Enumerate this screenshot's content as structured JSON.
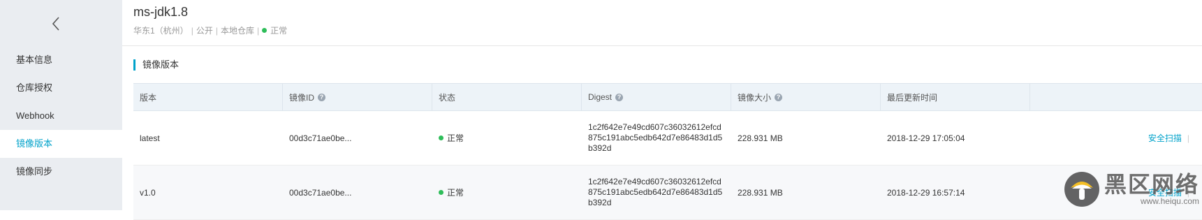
{
  "sidebar": {
    "back_icon": "chevron-left-icon",
    "items": [
      {
        "label": "基本信息",
        "active": false
      },
      {
        "label": "仓库授权",
        "active": false
      },
      {
        "label": "Webhook",
        "active": false
      },
      {
        "label": "镜像版本",
        "active": true
      },
      {
        "label": "镜像同步",
        "active": false
      }
    ]
  },
  "header": {
    "title": "ms-jdk1.8",
    "region": "华东1（杭州）",
    "visibility": "公开",
    "repo_type": "本地仓库",
    "status": "正常",
    "status_color": "#2ebd59"
  },
  "section": {
    "title": "镜像版本"
  },
  "table": {
    "columns": [
      "版本",
      "镜像ID",
      "状态",
      "Digest",
      "镜像大小",
      "最后更新时间",
      ""
    ],
    "rows": [
      {
        "version": "latest",
        "image_id": "00d3c71ae0be...",
        "status": "正常",
        "digest": "1c2f642e7e49cd607c36032612efcd875c191abc5edb642d7e86483d1d5b392d",
        "size": "228.931 MB",
        "updated": "2018-12-29 17:05:04",
        "action": "安全扫描"
      },
      {
        "version": "v1.0",
        "image_id": "00d3c71ae0be...",
        "status": "正常",
        "digest": "1c2f642e7e49cd607c36032612efcd875c191abc5edb642d7e86483d1d5b392d",
        "size": "228.931 MB",
        "updated": "2018-12-29 16:57:14",
        "action": "安全扫描"
      }
    ]
  },
  "watermark": {
    "name": "黑区网络",
    "url": "www.heiqu.com"
  },
  "colors": {
    "accent": "#00a2ca",
    "sidebar_bg": "#eaedf1",
    "header_bg": "#edf3f8"
  }
}
